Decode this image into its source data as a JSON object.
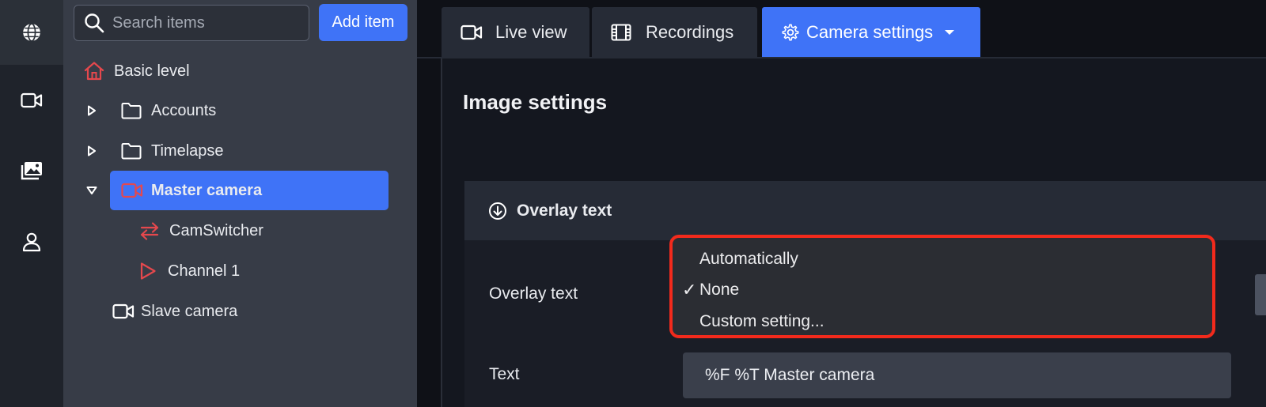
{
  "search": {
    "placeholder": "Search items"
  },
  "toolbar": {
    "add_label": "Add item"
  },
  "tree": {
    "items": [
      {
        "label": "Basic level"
      },
      {
        "label": "Accounts"
      },
      {
        "label": "Timelapse"
      },
      {
        "label": "Master camera"
      },
      {
        "label": "CamSwitcher"
      },
      {
        "label": "Channel 1"
      },
      {
        "label": "Slave camera"
      }
    ]
  },
  "tabs": [
    {
      "label": "Live view"
    },
    {
      "label": "Recordings"
    },
    {
      "label": "Camera settings"
    }
  ],
  "page": {
    "title": "Image settings"
  },
  "panel": {
    "header": "Overlay text",
    "overlay_label": "Overlay text",
    "text_label": "Text",
    "text_value": "%F %T Master camera"
  },
  "dropdown": {
    "options": [
      {
        "label": "Automatically",
        "checked": false
      },
      {
        "label": "None",
        "checked": true
      },
      {
        "label": "Custom setting...",
        "checked": false
      }
    ],
    "check_mark": "✓"
  },
  "colors": {
    "accent": "#3f73f7",
    "icon_red": "#e5484d",
    "highlight_border": "#f22a1c"
  }
}
